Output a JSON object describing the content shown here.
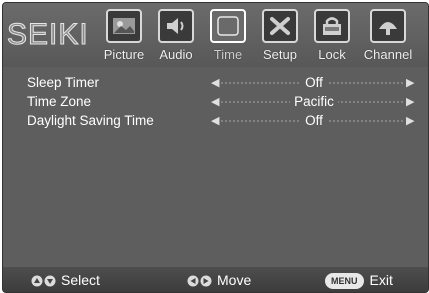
{
  "brand": "SEIKI",
  "tabs": [
    {
      "label": "Picture",
      "icon": "picture-icon",
      "active": false
    },
    {
      "label": "Audio",
      "icon": "audio-icon",
      "active": false
    },
    {
      "label": "Time",
      "icon": "time-icon",
      "active": true
    },
    {
      "label": "Setup",
      "icon": "setup-icon",
      "active": false
    },
    {
      "label": "Lock",
      "icon": "lock-icon",
      "active": false
    },
    {
      "label": "Channel",
      "icon": "channel-icon",
      "active": false
    }
  ],
  "settings": [
    {
      "label": "Sleep Timer",
      "value": "Off"
    },
    {
      "label": "Time Zone",
      "value": "Pacific"
    },
    {
      "label": "Daylight Saving Time",
      "value": "Off"
    }
  ],
  "footer": {
    "select_label": "Select",
    "move_label": "Move",
    "menu_key": "MENU",
    "exit_label": "Exit"
  },
  "colors": {
    "background": "#5e5e5e",
    "text": "#ffffff"
  }
}
